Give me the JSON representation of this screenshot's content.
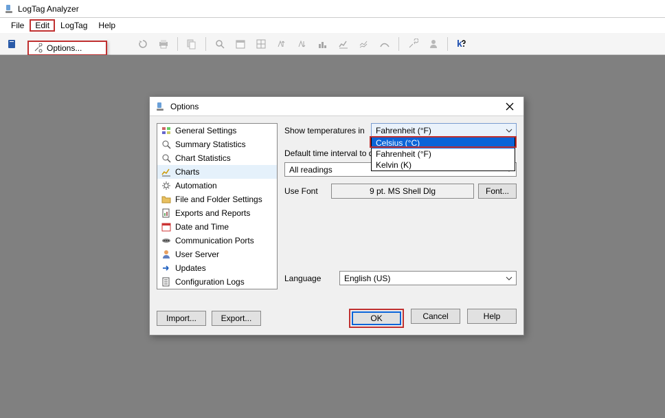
{
  "title": "LogTag Analyzer",
  "menubar": {
    "file": "File",
    "edit": "Edit",
    "logtag": "LogTag",
    "help": "Help"
  },
  "edit_menu": {
    "options": "Options..."
  },
  "dialog": {
    "title": "Options",
    "close": "×",
    "sidebar": {
      "items": [
        {
          "label": "General Settings"
        },
        {
          "label": "Summary Statistics"
        },
        {
          "label": "Chart Statistics"
        },
        {
          "label": "Charts"
        },
        {
          "label": "Automation"
        },
        {
          "label": "File and Folder Settings"
        },
        {
          "label": "Exports and Reports"
        },
        {
          "label": "Date and Time"
        },
        {
          "label": "Communication Ports"
        },
        {
          "label": "User Server"
        },
        {
          "label": "Updates"
        },
        {
          "label": "Configuration Logs"
        }
      ]
    },
    "form": {
      "temp_label": "Show temperatures in",
      "temp_value": "Fahrenheit (°F)",
      "temp_options": {
        "celsius": "Celsius (°C)",
        "fahrenheit": "Fahrenheit (°F)",
        "kelvin": "Kelvin (K)"
      },
      "interval_label": "Default time interval to dis",
      "interval_value": "All readings",
      "font_label": "Use Font",
      "font_value": "9 pt. MS Shell Dlg",
      "font_btn": "Font...",
      "lang_label": "Language",
      "lang_value": "English (US)"
    },
    "buttons": {
      "import": "Import...",
      "export": "Export...",
      "ok": "OK",
      "cancel": "Cancel",
      "help": "Help"
    }
  }
}
